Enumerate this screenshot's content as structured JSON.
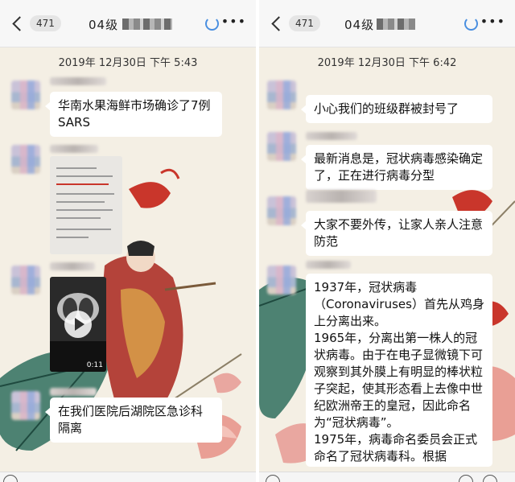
{
  "left": {
    "header": {
      "back_count": "471",
      "title": "04级"
    },
    "timestamp": "2019年 12月30日 下午 5:43",
    "messages": [
      "华南水果海鲜市场确诊了7例SARS",
      "在我们医院后湖院区急诊科隔离"
    ],
    "video": {
      "duration": "0:11"
    }
  },
  "right": {
    "header": {
      "back_count": "471",
      "title": "04级"
    },
    "timestamp": "2019年 12月30日 下午 6:42",
    "messages": [
      "小心我们的班级群被封号了",
      "最新消息是，冠状病毒感染确定了，正在进行病毒分型",
      "大家不要外传，让家人亲人注意防范",
      "1937年，冠状病毒（Coronaviruses）首先从鸡身上分离出来。\n1965年，分离出第一株人的冠状病毒。由于在电子显微镜下可观察到其外膜上有明显的棒状粒子突起，使其形态看上去像中世纪欧洲帝王的皇冠，因此命名为“冠状病毒”。\n1975年，病毒命名委员会正式命名了冠状病毒科。根据"
    ]
  },
  "icons": [
    "back-chevron-icon",
    "refresh-icon",
    "more-icon",
    "play-icon"
  ],
  "colors": {
    "chat_bg": "#f3eee3",
    "bubble": "#ffffff",
    "header": "#f7f7f7",
    "accent": "#4a8fe0"
  }
}
